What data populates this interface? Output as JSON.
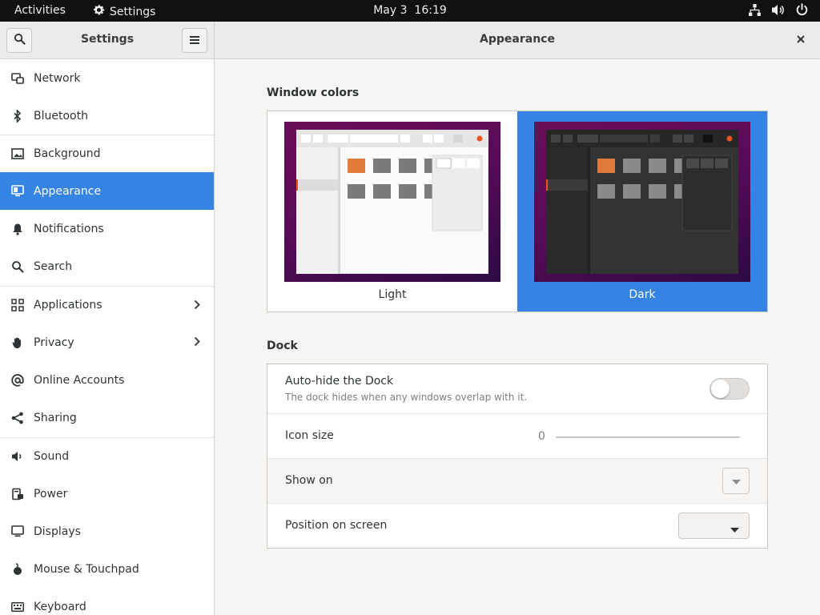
{
  "topbar": {
    "activities": "Activities",
    "app_name": "Settings",
    "clock_date": "May 3",
    "clock_time": "16:19"
  },
  "sidebar": {
    "title": "Settings",
    "items": [
      {
        "label": "Network",
        "icon": "network-icon"
      },
      {
        "label": "Bluetooth",
        "icon": "bluetooth-icon"
      },
      {
        "label": "Background",
        "icon": "background-icon"
      },
      {
        "label": "Appearance",
        "icon": "appearance-icon",
        "active": true
      },
      {
        "label": "Notifications",
        "icon": "bell-icon"
      },
      {
        "label": "Search",
        "icon": "search-icon"
      },
      {
        "label": "Applications",
        "icon": "grid-icon",
        "has_submenu": true
      },
      {
        "label": "Privacy",
        "icon": "hand-icon",
        "has_submenu": true
      },
      {
        "label": "Online Accounts",
        "icon": "at-icon"
      },
      {
        "label": "Sharing",
        "icon": "share-icon"
      },
      {
        "label": "Sound",
        "icon": "speaker-icon"
      },
      {
        "label": "Power",
        "icon": "power-plug-icon"
      },
      {
        "label": "Displays",
        "icon": "display-icon"
      },
      {
        "label": "Mouse & Touchpad",
        "icon": "mouse-icon"
      },
      {
        "label": "Keyboard",
        "icon": "keyboard-icon"
      }
    ]
  },
  "main": {
    "title": "Appearance",
    "window_colors": {
      "title": "Window colors",
      "options": [
        {
          "label": "Light",
          "selected": false
        },
        {
          "label": "Dark",
          "selected": true
        }
      ]
    },
    "dock": {
      "title": "Dock",
      "autohide": {
        "label": "Auto-hide the Dock",
        "description": "The dock hides when any windows overlap with it.",
        "enabled": false
      },
      "icon_size": {
        "label": "Icon size",
        "value": "0"
      },
      "show_on": {
        "label": "Show on"
      },
      "position": {
        "label": "Position on screen"
      }
    }
  },
  "colors": {
    "accent": "#3584e4",
    "topbar": "#111111",
    "sidebar_bg": "#ffffff",
    "content_bg": "#f6f5f4"
  }
}
